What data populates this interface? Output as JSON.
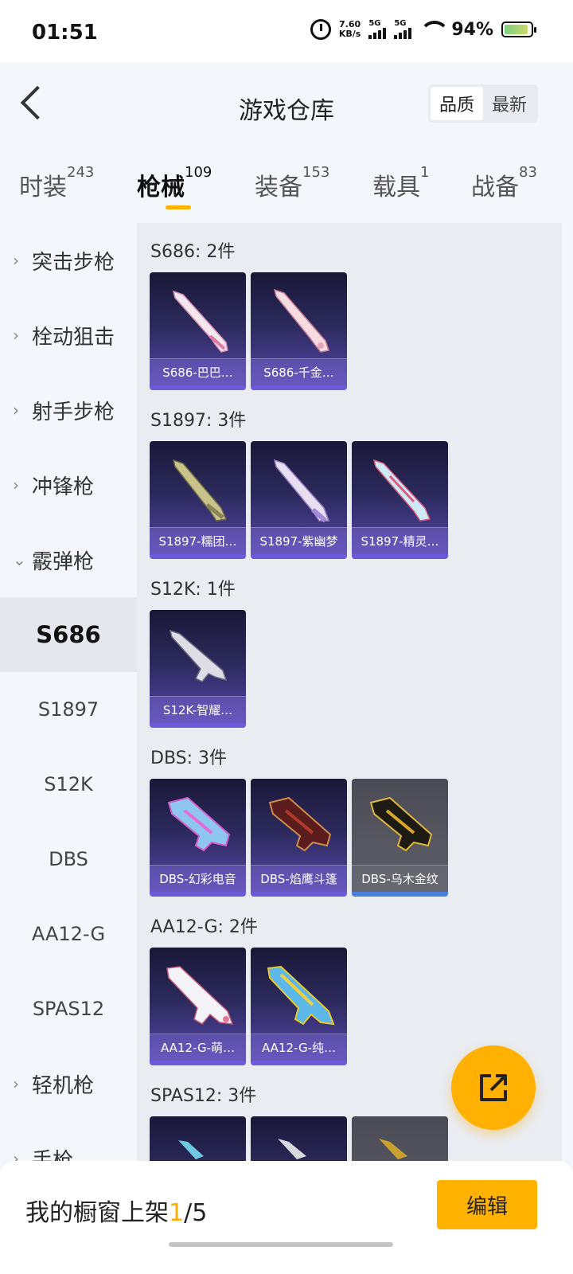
{
  "status_bar": {
    "time": "01:51",
    "speed_value": "7.60",
    "speed_unit": "KB/s",
    "signal1": "5G",
    "signal2": "5G",
    "battery": "94%"
  },
  "header": {
    "title": "游戏仓库",
    "sort_options": [
      "品质",
      "最新"
    ],
    "active_sort": "品质"
  },
  "tabs": [
    {
      "label": "时装",
      "count": "243"
    },
    {
      "label": "枪械",
      "count": "109",
      "active": true
    },
    {
      "label": "装备",
      "count": "153"
    },
    {
      "label": "载具",
      "count": "1"
    },
    {
      "label": "战备",
      "count": "83"
    }
  ],
  "sidebar": {
    "categories": [
      "突击步枪",
      "栓动狙击",
      "射手步枪",
      "冲锋枪",
      "霰弹枪"
    ],
    "subitems": [
      "S686",
      "S1897",
      "S12K",
      "DBS",
      "AA12-G",
      "SPAS12"
    ],
    "active_subitem": "S686",
    "after_categories": [
      "轻机枪",
      "手枪"
    ]
  },
  "groups": [
    {
      "title": "S686: 2件",
      "items": [
        "S686-巴巴…",
        "S686-千金…"
      ]
    },
    {
      "title": "S1897: 3件",
      "items": [
        "S1897-糯团…",
        "S1897-紫幽梦",
        "S1897-精灵…"
      ]
    },
    {
      "title": "S12K: 1件",
      "items": [
        "S12K-智耀…"
      ]
    },
    {
      "title": "DBS: 3件",
      "items": [
        "DBS-幻彩电音",
        "DBS-焰鹰斗篷",
        "DBS-乌木金纹"
      ]
    },
    {
      "title": "AA12-G: 2件",
      "items": [
        "AA12-G-萌…",
        "AA12-G-纯…"
      ]
    },
    {
      "title": "SPAS12: 3件",
      "items": [
        "",
        "",
        ""
      ]
    }
  ],
  "bottom": {
    "text_prefix": "我的橱窗上架",
    "current": "1",
    "total": "/5",
    "edit_label": "编辑"
  },
  "colors": {
    "accent": "#ffb300",
    "card_purple": "#5848b0",
    "card_gray": "#575861"
  }
}
